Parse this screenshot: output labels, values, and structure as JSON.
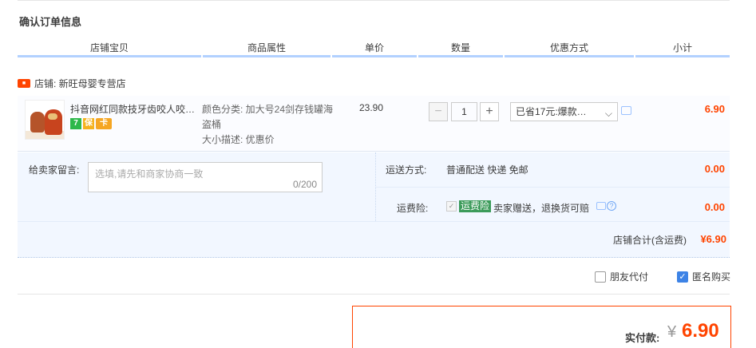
{
  "page": {
    "title": "确认订单信息"
  },
  "table_headers": [
    "店铺宝贝",
    "商品属性",
    "单价",
    "数量",
    "优惠方式",
    "小计"
  ],
  "shop": {
    "icon": "shop-tag-icon",
    "label": "店铺: 新旺母婴专营店"
  },
  "item": {
    "title": "抖音网红同款技牙齿咬人咬…",
    "badges": [
      "7",
      "保",
      "卡"
    ],
    "props": {
      "color": "颜色分类: 加大号24剑存钱罐海盗桶",
      "size": "大小描述: 优惠价"
    },
    "price": "23.90",
    "quantity": "1",
    "minus_label": "−",
    "plus_label": "+",
    "discount_selected": "已省17元:爆款…",
    "subtotal": "6.90"
  },
  "memo": {
    "label": "给卖家留言:",
    "placeholder": "选填,请先和商家协商一致",
    "counter": "0/200"
  },
  "shipping": {
    "label": "运送方式:",
    "value": "普通配送 快递 免邮",
    "amount": "0.00"
  },
  "insurance": {
    "label": "运费险:",
    "tag": "运费险",
    "text": "卖家赠送，退换货可赔",
    "amount": "0.00"
  },
  "shop_total": {
    "label": "店铺合计(含运费)",
    "amount": "¥6.90"
  },
  "options": [
    {
      "label": "朋友代付",
      "checked": false
    },
    {
      "label": "匿名购买",
      "checked": true
    }
  ],
  "payment": {
    "label": "实付款:",
    "currency": "¥",
    "amount": "6.90"
  },
  "colors": {
    "accent": "#ff4400",
    "header_underline": "#b2d1ff",
    "panel_bg": "#f2f7ff",
    "checkbox_on": "#3d83e6"
  }
}
